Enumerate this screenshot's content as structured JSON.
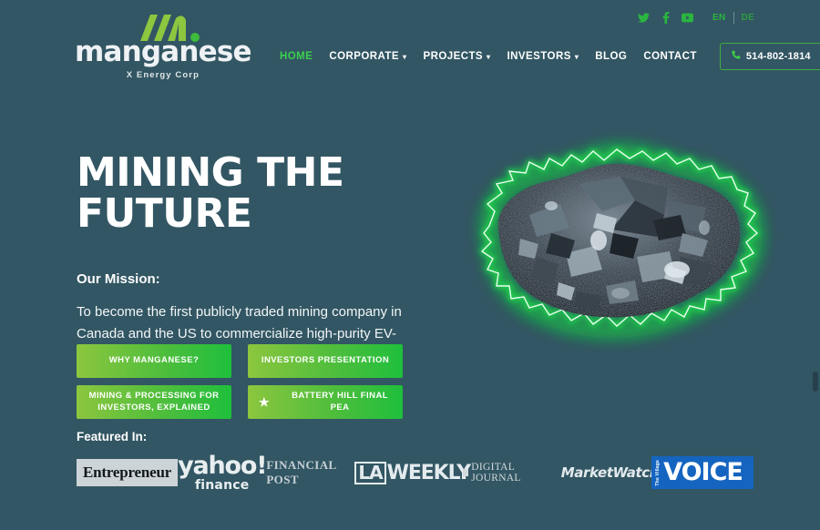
{
  "topbar": {
    "social": [
      {
        "name": "twitter-icon",
        "label": "Twitter"
      },
      {
        "name": "facebook-icon",
        "label": "Facebook"
      },
      {
        "name": "youtube-icon",
        "label": "YouTube"
      }
    ],
    "lang_current": "EN",
    "lang_alt": "DE"
  },
  "logo": {
    "word": "manganese",
    "sub": "X Energy Corp",
    "mark_color": "#8dc63f"
  },
  "nav": {
    "items": [
      {
        "label": "HOME",
        "caret": "",
        "active": true
      },
      {
        "label": "CORPORATE",
        "caret": "⌄",
        "active": false
      },
      {
        "label": "PROJECTS",
        "caret": "⌄",
        "active": false
      },
      {
        "label": "INVESTORS",
        "caret": "⌄",
        "active": false
      },
      {
        "label": "BLOG",
        "caret": "",
        "active": false
      },
      {
        "label": "CONTACT",
        "caret": "",
        "active": false
      }
    ],
    "phone": "514-802-1814"
  },
  "hero": {
    "headline": "MINING THE FUTURE",
    "mission_label": "Our Mission:",
    "mission_body": "To become the first publicly traded mining company in Canada and the US to commercialize high-purity EV-compliant manganese.",
    "image_alt": "manganese ore rock with green electric glow"
  },
  "buttons": [
    {
      "label": "WHY MANGANESE?",
      "icon": ""
    },
    {
      "label": "INVESTORS PRESENTATION",
      "icon": ""
    },
    {
      "label": "MINING & PROCESSING FOR INVESTORS, EXPLAINED",
      "icon": ""
    },
    {
      "label": "BATTERY HILL FINAL PEA",
      "icon": "★"
    }
  ],
  "featured": {
    "label": "Featured In:",
    "logos": [
      {
        "name": "entrepreneur-logo",
        "text": "Entrepreneur"
      },
      {
        "name": "yahoo-finance-logo",
        "text": "yahoo!",
        "text2": "finance"
      },
      {
        "name": "financial-post-logo",
        "text": "FINANCIAL POST"
      },
      {
        "name": "la-weekly-logo",
        "text": "LA",
        "text2": "WEEKLY"
      },
      {
        "name": "digital-journal-logo",
        "text": "DIGITAL JOURNAL"
      },
      {
        "name": "marketwatch-logo",
        "text": "MarketWatch"
      },
      {
        "name": "village-voice-logo",
        "text": "The Village",
        "text2": "VOICE"
      }
    ]
  },
  "colors": {
    "background": "#325663",
    "accent_green": "#3ccf4e",
    "btn_gradient_start": "#8cc63e",
    "btn_gradient_end": "#1fbf3c",
    "voice_blue": "#1565c0"
  }
}
